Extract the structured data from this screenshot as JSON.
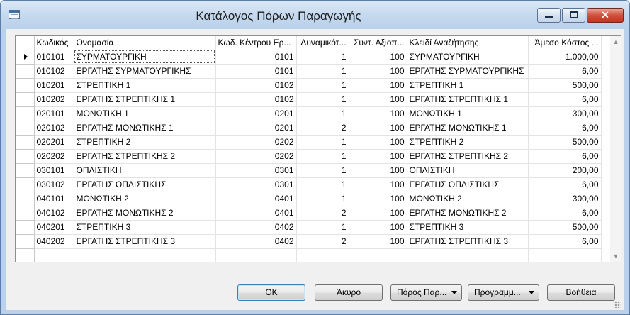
{
  "window": {
    "title": "Κατάλογος Πόρων Παραγωγής",
    "controls": {
      "minimize": "minimize",
      "maximize": "maximize",
      "close": "close"
    }
  },
  "table": {
    "columns": [
      "Κωδικός",
      "Ονομασία",
      "Κωδ. Κέντρου Ερ...",
      "Δυναμικότ...",
      "Συντ. Αξιοπ...",
      "Κλειδί Αναζήτησης",
      "Άμεσο Κόστος ..."
    ],
    "rows": [
      {
        "code": "010101",
        "name": "ΣΥΡΜΑΤΟΥΡΓΙΚΗ",
        "center": "0101",
        "capacity": "1",
        "factor": "100",
        "search": "ΣΥΡΜΑΤΟΥΡΓΙΚΗ",
        "cost": "1.000,00"
      },
      {
        "code": "010102",
        "name": "ΕΡΓΑΤΗΣ ΣΥΡΜΑΤΟΥΡΓΙΚΗΣ",
        "center": "0101",
        "capacity": "1",
        "factor": "100",
        "search": "ΕΡΓΑΤΗΣ ΣΥΡΜΑΤΟΥΡΓΙΚΗΣ",
        "cost": "6,00"
      },
      {
        "code": "010201",
        "name": "ΣΤΡΕΠΤΙΚΗ 1",
        "center": "0102",
        "capacity": "1",
        "factor": "100",
        "search": "ΣΤΡΕΠΤΙΚΗ 1",
        "cost": "500,00"
      },
      {
        "code": "010202",
        "name": "ΕΡΓΑΤΗΣ ΣΤΡΕΠΤΙΚΗΣ 1",
        "center": "0102",
        "capacity": "1",
        "factor": "100",
        "search": "ΕΡΓΑΤΗΣ ΣΤΡΕΠΤΙΚΗΣ 1",
        "cost": "6,00"
      },
      {
        "code": "020101",
        "name": "ΜΟΝΩΤΙΚΗ 1",
        "center": "0201",
        "capacity": "1",
        "factor": "100",
        "search": "ΜΟΝΩΤΙΚΗ 1",
        "cost": "300,00"
      },
      {
        "code": "020102",
        "name": "ΕΡΓΑΤΗΣ ΜΟΝΩΤΙΚΗΣ 1",
        "center": "0201",
        "capacity": "2",
        "factor": "100",
        "search": "ΕΡΓΑΤΗΣ ΜΟΝΩΤΙΚΗΣ 1",
        "cost": "6,00"
      },
      {
        "code": "020201",
        "name": "ΣΤΡΕΠΤΙΚΗ 2",
        "center": "0202",
        "capacity": "1",
        "factor": "100",
        "search": "ΣΤΡΕΠΤΙΚΗ 2",
        "cost": "500,00"
      },
      {
        "code": "020202",
        "name": "ΕΡΓΑΤΗΣ ΣΤΡΕΠΤΙΚΗΣ 2",
        "center": "0202",
        "capacity": "1",
        "factor": "100",
        "search": "ΕΡΓΑΤΗΣ ΣΤΡΕΠΤΙΚΗΣ 2",
        "cost": "6,00"
      },
      {
        "code": "030101",
        "name": "ΟΠΛΙΣΤΙΚΗ",
        "center": "0301",
        "capacity": "1",
        "factor": "100",
        "search": "ΟΠΛΙΣΤΙΚΗ",
        "cost": "200,00"
      },
      {
        "code": "030102",
        "name": "ΕΡΓΑΤΗΣ ΟΠΛΙΣΤΙΚΗΣ",
        "center": "0301",
        "capacity": "1",
        "factor": "100",
        "search": "ΕΡΓΑΤΗΣ ΟΠΛΙΣΤΙΚΗΣ",
        "cost": "6,00"
      },
      {
        "code": "040101",
        "name": "ΜΟΝΩΤΙΚΗ 2",
        "center": "0401",
        "capacity": "1",
        "factor": "100",
        "search": "ΜΟΝΩΤΙΚΗ 2",
        "cost": "300,00"
      },
      {
        "code": "040102",
        "name": "ΕΡΓΑΤΗΣ ΜΟΝΩΤΙΚΗΣ 2",
        "center": "0401",
        "capacity": "2",
        "factor": "100",
        "search": "ΕΡΓΑΤΗΣ ΜΟΝΩΤΙΚΗΣ 2",
        "cost": "6,00"
      },
      {
        "code": "040201",
        "name": "ΣΤΡΕΠΤΙΚΗ 3",
        "center": "0402",
        "capacity": "1",
        "factor": "100",
        "search": "ΣΤΡΕΠΤΙΚΗ 3",
        "cost": "500,00"
      },
      {
        "code": "040202",
        "name": "ΕΡΓΑΤΗΣ ΣΤΡΕΠΤΙΚΗΣ 3",
        "center": "0402",
        "capacity": "2",
        "factor": "100",
        "search": "ΕΡΓΑΤΗΣ ΣΤΡΕΠΤΙΚΗΣ 3",
        "cost": "6,00"
      }
    ]
  },
  "buttons": {
    "ok": "OK",
    "cancel": "Άκυρο",
    "resource": "Πόρος Παρ...",
    "program": "Προγραμμ...",
    "help": "Βοήθεια"
  }
}
